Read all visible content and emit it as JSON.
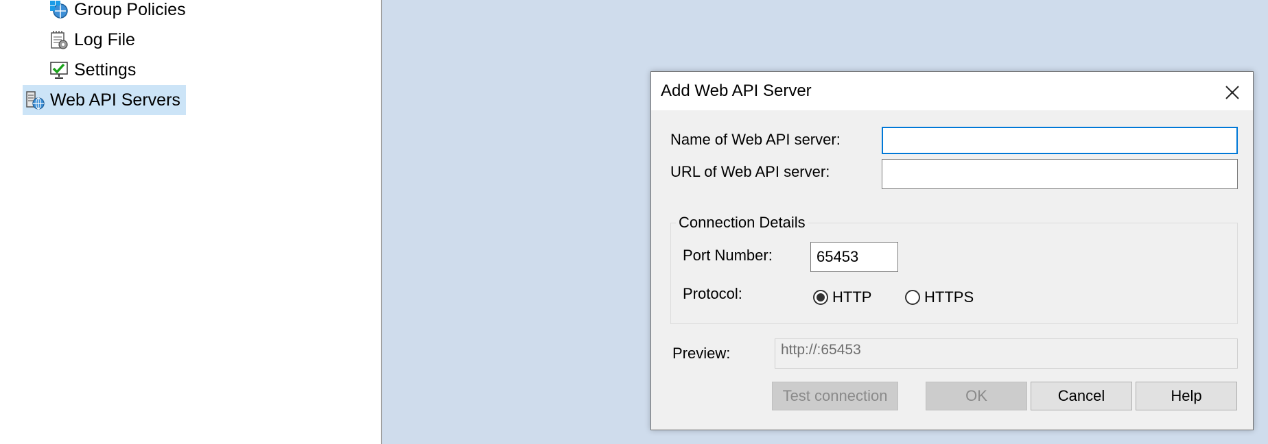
{
  "tree": {
    "items": [
      {
        "label": "Group Policies",
        "icon": "group-policies-icon"
      },
      {
        "label": "Log File",
        "icon": "log-file-icon"
      },
      {
        "label": "Settings",
        "icon": "settings-icon"
      },
      {
        "label": "Web API Servers",
        "icon": "web-api-servers-icon",
        "selected": true
      }
    ]
  },
  "dialog": {
    "title": "Add Web API Server",
    "name_label": "Name of Web API server:",
    "name_value": "",
    "url_label": "URL of Web API server:",
    "url_value": "",
    "connection_group": "Connection Details",
    "port_label": "Port Number:",
    "port_value": "65453",
    "protocol_label": "Protocol:",
    "protocol_options": [
      "HTTP",
      "HTTPS"
    ],
    "protocol_selected": "HTTP",
    "preview_label": "Preview:",
    "preview_value": "http://:65453",
    "buttons": {
      "test": "Test connection",
      "ok": "OK",
      "cancel": "Cancel",
      "help": "Help"
    }
  },
  "colors": {
    "workspace_bg": "#cfdcec",
    "selection_bg": "#cce4f7",
    "focus_border": "#0078d7"
  }
}
